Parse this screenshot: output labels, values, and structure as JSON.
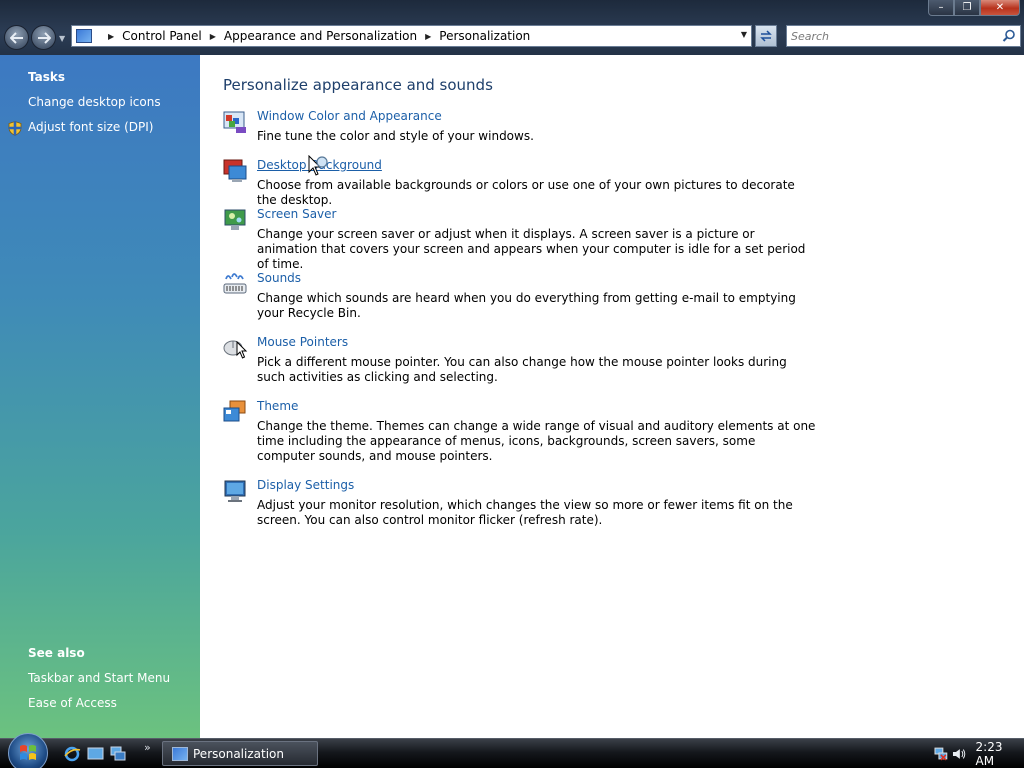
{
  "window": {
    "controls": {
      "minimize": "–",
      "maximize": "❐",
      "close": "✕"
    }
  },
  "addressbar": {
    "crumbs": [
      "Control Panel",
      "Appearance and Personalization",
      "Personalization"
    ]
  },
  "search": {
    "placeholder": "Search"
  },
  "sidebar": {
    "tasks_heading": "Tasks",
    "tasks": [
      "Change desktop icons",
      "Adjust font size (DPI)"
    ],
    "see_also_heading": "See also",
    "see_also": [
      "Taskbar and Start Menu",
      "Ease of Access"
    ]
  },
  "main": {
    "title": "Personalize appearance and sounds",
    "items": [
      {
        "label": "Window Color and Appearance",
        "desc": "Fine tune the color and style of your windows.",
        "icon": "window-color-icon"
      },
      {
        "label": "Desktop Background",
        "desc": "Choose from available backgrounds or colors or use one of your own pictures to decorate the desktop.",
        "icon": "desktop-background-icon"
      },
      {
        "label": "Screen Saver",
        "desc": "Change your screen saver or adjust when it displays. A screen saver is a picture or animation that covers your screen and appears when your computer is idle for a set period of time.",
        "icon": "screen-saver-icon"
      },
      {
        "label": "Sounds",
        "desc": "Change which sounds are heard when you do everything from getting e-mail to emptying your Recycle Bin.",
        "icon": "sounds-icon"
      },
      {
        "label": "Mouse Pointers",
        "desc": "Pick a different mouse pointer. You can also change how the mouse pointer looks during such activities as clicking and selecting.",
        "icon": "mouse-pointers-icon"
      },
      {
        "label": "Theme",
        "desc": "Change the theme. Themes can change a wide range of visual and auditory elements at one time including the appearance of menus, icons, backgrounds, screen savers, some computer sounds, and mouse pointers.",
        "icon": "theme-icon"
      },
      {
        "label": "Display Settings",
        "desc": "Adjust your monitor resolution, which changes the view so more or fewer items fit on the screen. You can also control monitor flicker (refresh rate).",
        "icon": "display-settings-icon"
      }
    ]
  },
  "taskbar": {
    "task": "Personalization",
    "more": "»",
    "clock": "2:23 AM"
  },
  "colors": {
    "link": "#1c5fa8",
    "title": "#1e3f6b",
    "sidebar_top": "#3d79c2",
    "sidebar_bottom": "#6cc27f"
  }
}
